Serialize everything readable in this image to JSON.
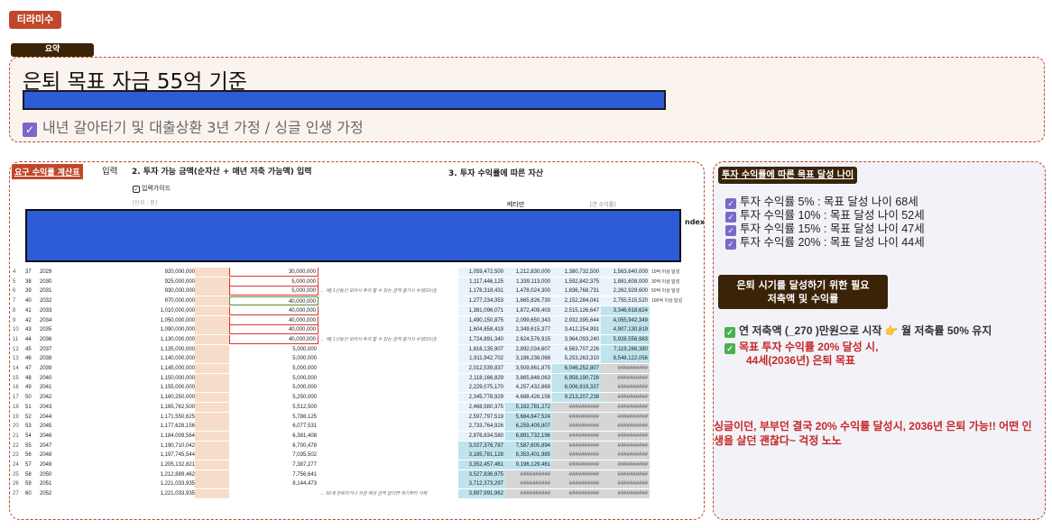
{
  "author_tag": "티라미수",
  "summary": {
    "tag": "요약",
    "title": "은퇴 목표 자금 55억 기준",
    "note_check": "✓",
    "note": "내년 갈아타기 및 대출상환 3년 가정 / 싱글 인생 가정"
  },
  "calc": {
    "badge": "요구 수익률 계산표",
    "input_label": "입력",
    "section2_title": "2. 투자 가능 금액(순자산 + 매년 저축 가능액) 입력",
    "guide": "입력가이드",
    "unit": "[단위 : 원]",
    "section3_title": "3. 투자 수익률에 따른 자산",
    "beta_label": "베타만",
    "annual_label": "[연 수익률]",
    "index_header": "ndex",
    "rows": [
      {
        "i": "4",
        "age": "37",
        "year": "2029",
        "asset": "920,000,000",
        "sav": "30,000,000",
        "note": "",
        "r5": "1,059,472,500",
        "r10": "1,212,830,000",
        "r15": "1,380,732,500",
        "r20": "1,563,840,000",
        "lab": "10억 이상 달성",
        "h": ""
      },
      {
        "i": "5",
        "age": "38",
        "year": "2030",
        "asset": "925,000,000",
        "sav": "5,000,000",
        "note": "",
        "r5": "1,117,446,125",
        "r10": "1,339,113,000",
        "r15": "1,592,842,375",
        "r20": "1,881,608,000",
        "lab": "30억 이상 달성",
        "h": ""
      },
      {
        "i": "6",
        "age": "39",
        "year": "2031",
        "asset": "930,000,000",
        "sav": "5,000,000",
        "note": "← 예) 1년동안 모아서 투자 할 수 있는 금액 증가시 수정(10년)",
        "r5": "1,178,318,431",
        "r10": "1,478,024,300",
        "r15": "1,836,768,731",
        "r20": "2,262,929,600",
        "lab": "50억 이상 달성",
        "h": ""
      },
      {
        "i": "7",
        "age": "40",
        "year": "2032",
        "asset": "970,000,000",
        "sav": "40,000,000",
        "note": "",
        "r5": "1,277,234,353",
        "r10": "1,665,826,730",
        "r15": "2,152,284,041",
        "r20": "2,755,515,520",
        "lab": "100억 이상 달성",
        "h": "",
        "green": true
      },
      {
        "i": "8",
        "age": "41",
        "year": "2033",
        "asset": "1,010,000,000",
        "sav": "40,000,000",
        "note": "",
        "r5": "1,381,096,071",
        "r10": "1,872,409,403",
        "r15": "2,515,126,647",
        "r20": "3,346,618,624",
        "lab": "",
        "h": "r20"
      },
      {
        "i": "9",
        "age": "42",
        "year": "2034",
        "asset": "1,050,000,000",
        "sav": "40,000,000",
        "note": "",
        "r5": "1,490,150,875",
        "r10": "2,099,650,343",
        "r15": "2,932,395,644",
        "r20": "4,055,942,349",
        "lab": "",
        "h": "r20"
      },
      {
        "i": "10",
        "age": "43",
        "year": "2035",
        "asset": "1,090,000,000",
        "sav": "40,000,000",
        "note": "",
        "r5": "1,604,658,419",
        "r10": "2,349,615,377",
        "r15": "3,412,254,991",
        "r20": "4,907,130,819",
        "lab": "",
        "h": "r20"
      },
      {
        "i": "11",
        "age": "44",
        "year": "2036",
        "asset": "1,130,000,000",
        "sav": "40,000,000",
        "note": "← 예) 1년동안 모아서 투자 할 수 있는 금액 증가시 수정(10년)",
        "r5": "1,724,891,340",
        "r10": "2,624,576,915",
        "r15": "3,964,093,240",
        "r20": "5,928,556,983",
        "lab": "",
        "h": "r20"
      },
      {
        "i": "12",
        "age": "45",
        "year": "2037",
        "asset": "1,135,000,000",
        "sav": "5,000,000",
        "note": "",
        "r5": "1,816,135,907",
        "r10": "2,892,034,607",
        "r15": "4,563,707,226",
        "r20": "7,119,268,380",
        "lab": "",
        "h": "r20"
      },
      {
        "i": "13",
        "age": "46",
        "year": "2038",
        "asset": "1,140,000,000",
        "sav": "5,000,000",
        "note": "",
        "r5": "1,911,942,702",
        "r10": "3,186,238,068",
        "r15": "5,253,263,310",
        "r20": "8,548,122,056",
        "lab": "",
        "h": "r20"
      },
      {
        "i": "14",
        "age": "47",
        "year": "2039",
        "asset": "1,145,000,000",
        "sav": "5,000,000",
        "note": "",
        "r5": "2,012,539,837",
        "r10": "3,509,861,875",
        "r15": "6,046,252,807",
        "r20": "##########",
        "lab": "",
        "h": "r20x"
      },
      {
        "i": "15",
        "age": "48",
        "year": "2040",
        "asset": "1,150,000,000",
        "sav": "5,000,000",
        "note": "",
        "r5": "2,118,166,829",
        "r10": "3,865,848,063",
        "r15": "6,958,190,728",
        "r20": "##########",
        "lab": "",
        "h": "r20x"
      },
      {
        "i": "16",
        "age": "49",
        "year": "2041",
        "asset": "1,155,000,000",
        "sav": "5,000,000",
        "note": "",
        "r5": "2,229,075,170",
        "r10": "4,257,432,869",
        "r15": "8,006,919,337",
        "r20": "##########",
        "lab": "",
        "h": "r20x"
      },
      {
        "i": "17",
        "age": "50",
        "year": "2042",
        "asset": "1,160,250,000",
        "sav": "5,250,000",
        "note": "",
        "r5": "2,345,778,929",
        "r10": "4,688,426,156",
        "r15": "9,213,207,238",
        "r20": "##########",
        "lab": "",
        "h": "r20x"
      },
      {
        "i": "18",
        "age": "51",
        "year": "2043",
        "asset": "1,165,762,500",
        "sav": "5,512,500",
        "note": "",
        "r5": "2,468,580,375",
        "r10": "5,162,781,272",
        "r15": "##########",
        "r20": "##########",
        "lab": "",
        "h": "x"
      },
      {
        "i": "19",
        "age": "52",
        "year": "2044",
        "asset": "1,171,550,625",
        "sav": "5,788,125",
        "note": "",
        "r5": "2,597,797,519",
        "r10": "5,684,847,524",
        "r15": "##########",
        "r20": "##########",
        "lab": "",
        "h": "x"
      },
      {
        "i": "20",
        "age": "53",
        "year": "2045",
        "asset": "1,177,628,156",
        "sav": "6,077,531",
        "note": "",
        "r5": "2,733,764,926",
        "r10": "6,259,409,807",
        "r15": "##########",
        "r20": "##########",
        "lab": "",
        "h": "x"
      },
      {
        "i": "21",
        "age": "54",
        "year": "2046",
        "asset": "1,184,009,564",
        "sav": "6,381,408",
        "note": "",
        "r5": "2,876,834,580",
        "r10": "6,891,732,196",
        "r15": "##########",
        "r20": "##########",
        "lab": "",
        "h": "x"
      },
      {
        "i": "22",
        "age": "55",
        "year": "2047",
        "asset": "1,190,710,042",
        "sav": "6,700,478",
        "note": "",
        "r5": "3,027,376,787",
        "r10": "7,587,605,894",
        "r15": "##########",
        "r20": "##########",
        "lab": "",
        "h": "x5"
      },
      {
        "i": "23",
        "age": "56",
        "year": "2048",
        "asset": "1,197,745,544",
        "sav": "7,035,502",
        "note": "",
        "r5": "3,185,781,128",
        "r10": "8,353,401,985",
        "r15": "##########",
        "r20": "##########",
        "lab": "",
        "h": "x5"
      },
      {
        "i": "24",
        "age": "57",
        "year": "2049",
        "asset": "1,205,132,821",
        "sav": "7,387,277",
        "note": "",
        "r5": "3,352,457,461",
        "r10": "9,196,129,461",
        "r15": "##########",
        "r20": "##########",
        "lab": "",
        "h": "x5"
      },
      {
        "i": "25",
        "age": "58",
        "year": "2050",
        "asset": "1,212,889,462",
        "sav": "7,756,641",
        "note": "",
        "r5": "3,527,836,975",
        "r10": "##########",
        "r15": "##########",
        "r20": "##########",
        "lab": "",
        "h": "x5b"
      },
      {
        "i": "26",
        "age": "59",
        "year": "2051",
        "asset": "1,221,033,935",
        "sav": "8,144,473",
        "note": "",
        "r5": "3,712,373,297",
        "r10": "##########",
        "r15": "##########",
        "r20": "##########",
        "lab": "",
        "h": "x5b"
      },
      {
        "i": "27",
        "age": "60",
        "year": "2052",
        "asset": "1,221,033,935",
        "sav": "",
        "note": "← 60세 은퇴이거나 자금 예정 금액 없다면 여기부터 삭제",
        "r5": "3,897,991,962",
        "r10": "##########",
        "r15": "##########",
        "r20": "##########",
        "lab": "",
        "h": "x5b"
      }
    ]
  },
  "right": {
    "badge1": "투자 수익률에 따른 목표 달성 나이",
    "goals": [
      "투자 수익률 5% : 목표 달성 나이 68세",
      "투자 수익률 10% : 목표 달성 나이 52세",
      "투자 수익률 15% : 목표 달성 나이 47세",
      "투자 수익률 20% : 목표 달성 나이 44세"
    ],
    "badge2_line1": "은퇴 시기를 달성하기 위한 필요",
    "badge2_line2": "저축액 및 수익률",
    "need1": "연 저축액 (_270 )만원으로 시작 👉 월 저축률 50% 유지",
    "need2_line1": "목표 투자 수익률 20% 달성 시,",
    "need2_line2": "44세(2036년) 은퇴 목표",
    "final": "싱글이던, 부부던 결국 20% 수익률 달성시, 2036년 은퇴 가능!! 어떤 인생을 살던 괜찮다~ 걱정 노노"
  },
  "colors": {
    "accent": "#c0472b",
    "dark_badge": "#3b2308",
    "cover_blue": "#2e5bd6",
    "check_purple": "#7b68c8",
    "highlight_teal": "#bfe4ee"
  }
}
